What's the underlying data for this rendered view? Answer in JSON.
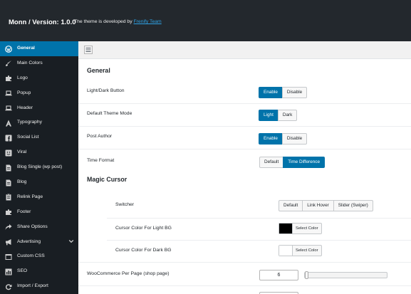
{
  "header": {
    "title": "Monn / Version: 1.0.0",
    "subtitle_prefix": "The theme is developed by",
    "developer_link": "Frenify Team"
  },
  "sidebar": {
    "items": [
      {
        "label": "General",
        "icon": "wordpress-icon",
        "active": true
      },
      {
        "label": "Main Colors",
        "icon": "brush-icon"
      },
      {
        "label": "Logo",
        "icon": "puzzle-icon"
      },
      {
        "label": "Popup",
        "icon": "laptop-icon"
      },
      {
        "label": "Header",
        "icon": "laptop-icon"
      },
      {
        "label": "Typography",
        "icon": "typography-icon"
      },
      {
        "label": "Social List",
        "icon": "facebook-icon"
      },
      {
        "label": "Viral",
        "icon": "smiley-icon"
      },
      {
        "label": "Blog Single (wp post)",
        "icon": "document-icon"
      },
      {
        "label": "Blog",
        "icon": "document-icon"
      },
      {
        "label": "Relink Page",
        "icon": "clipboard-icon"
      },
      {
        "label": "Footer",
        "icon": "puzzle-icon"
      },
      {
        "label": "Share Options",
        "icon": "share-icon"
      },
      {
        "label": "Advertising",
        "icon": "megaphone-icon",
        "chevron": "chevron-down-icon"
      },
      {
        "label": "Custom CSS",
        "icon": "code-icon"
      },
      {
        "label": "SEO",
        "icon": "chart-bars-icon"
      },
      {
        "label": "Import / Export",
        "icon": "refresh-icon"
      }
    ]
  },
  "toolbar": {
    "icon": "expand-options-icon"
  },
  "main": {
    "section_general": "General",
    "light_dark_button": {
      "label": "Light/Dark Button",
      "options": [
        "Enable",
        "Disable"
      ],
      "selected": "Enable"
    },
    "default_theme_mode": {
      "label": "Default Theme Mode",
      "options": [
        "Light",
        "Dark"
      ],
      "selected": "Light"
    },
    "post_author": {
      "label": "Post Author",
      "options": [
        "Enable",
        "Disable"
      ],
      "selected": "Enable"
    },
    "time_format": {
      "label": "Time Format",
      "options": [
        "Default",
        "Time Difference"
      ],
      "selected": "Time Difference"
    },
    "section_magic_cursor": "Magic Cursor",
    "switcher": {
      "label": "Switcher",
      "options": [
        "Default",
        "Link Hover",
        "Slider (Swiper)"
      ],
      "selected": ""
    },
    "cursor_light": {
      "label": "Cursor Color For Light BG",
      "button": "Select Color",
      "color": "#000000"
    },
    "cursor_dark": {
      "label": "Cursor Color For Dark BG",
      "button": "Select Color",
      "color": "#ffffff"
    },
    "woo_per_page": {
      "label": "WooCommerce Per Page (shop page)",
      "value": "6"
    }
  },
  "colors": {
    "accent": "#0073aa",
    "header_bg": "#23282d",
    "sidebar_bg": "#191e23"
  }
}
